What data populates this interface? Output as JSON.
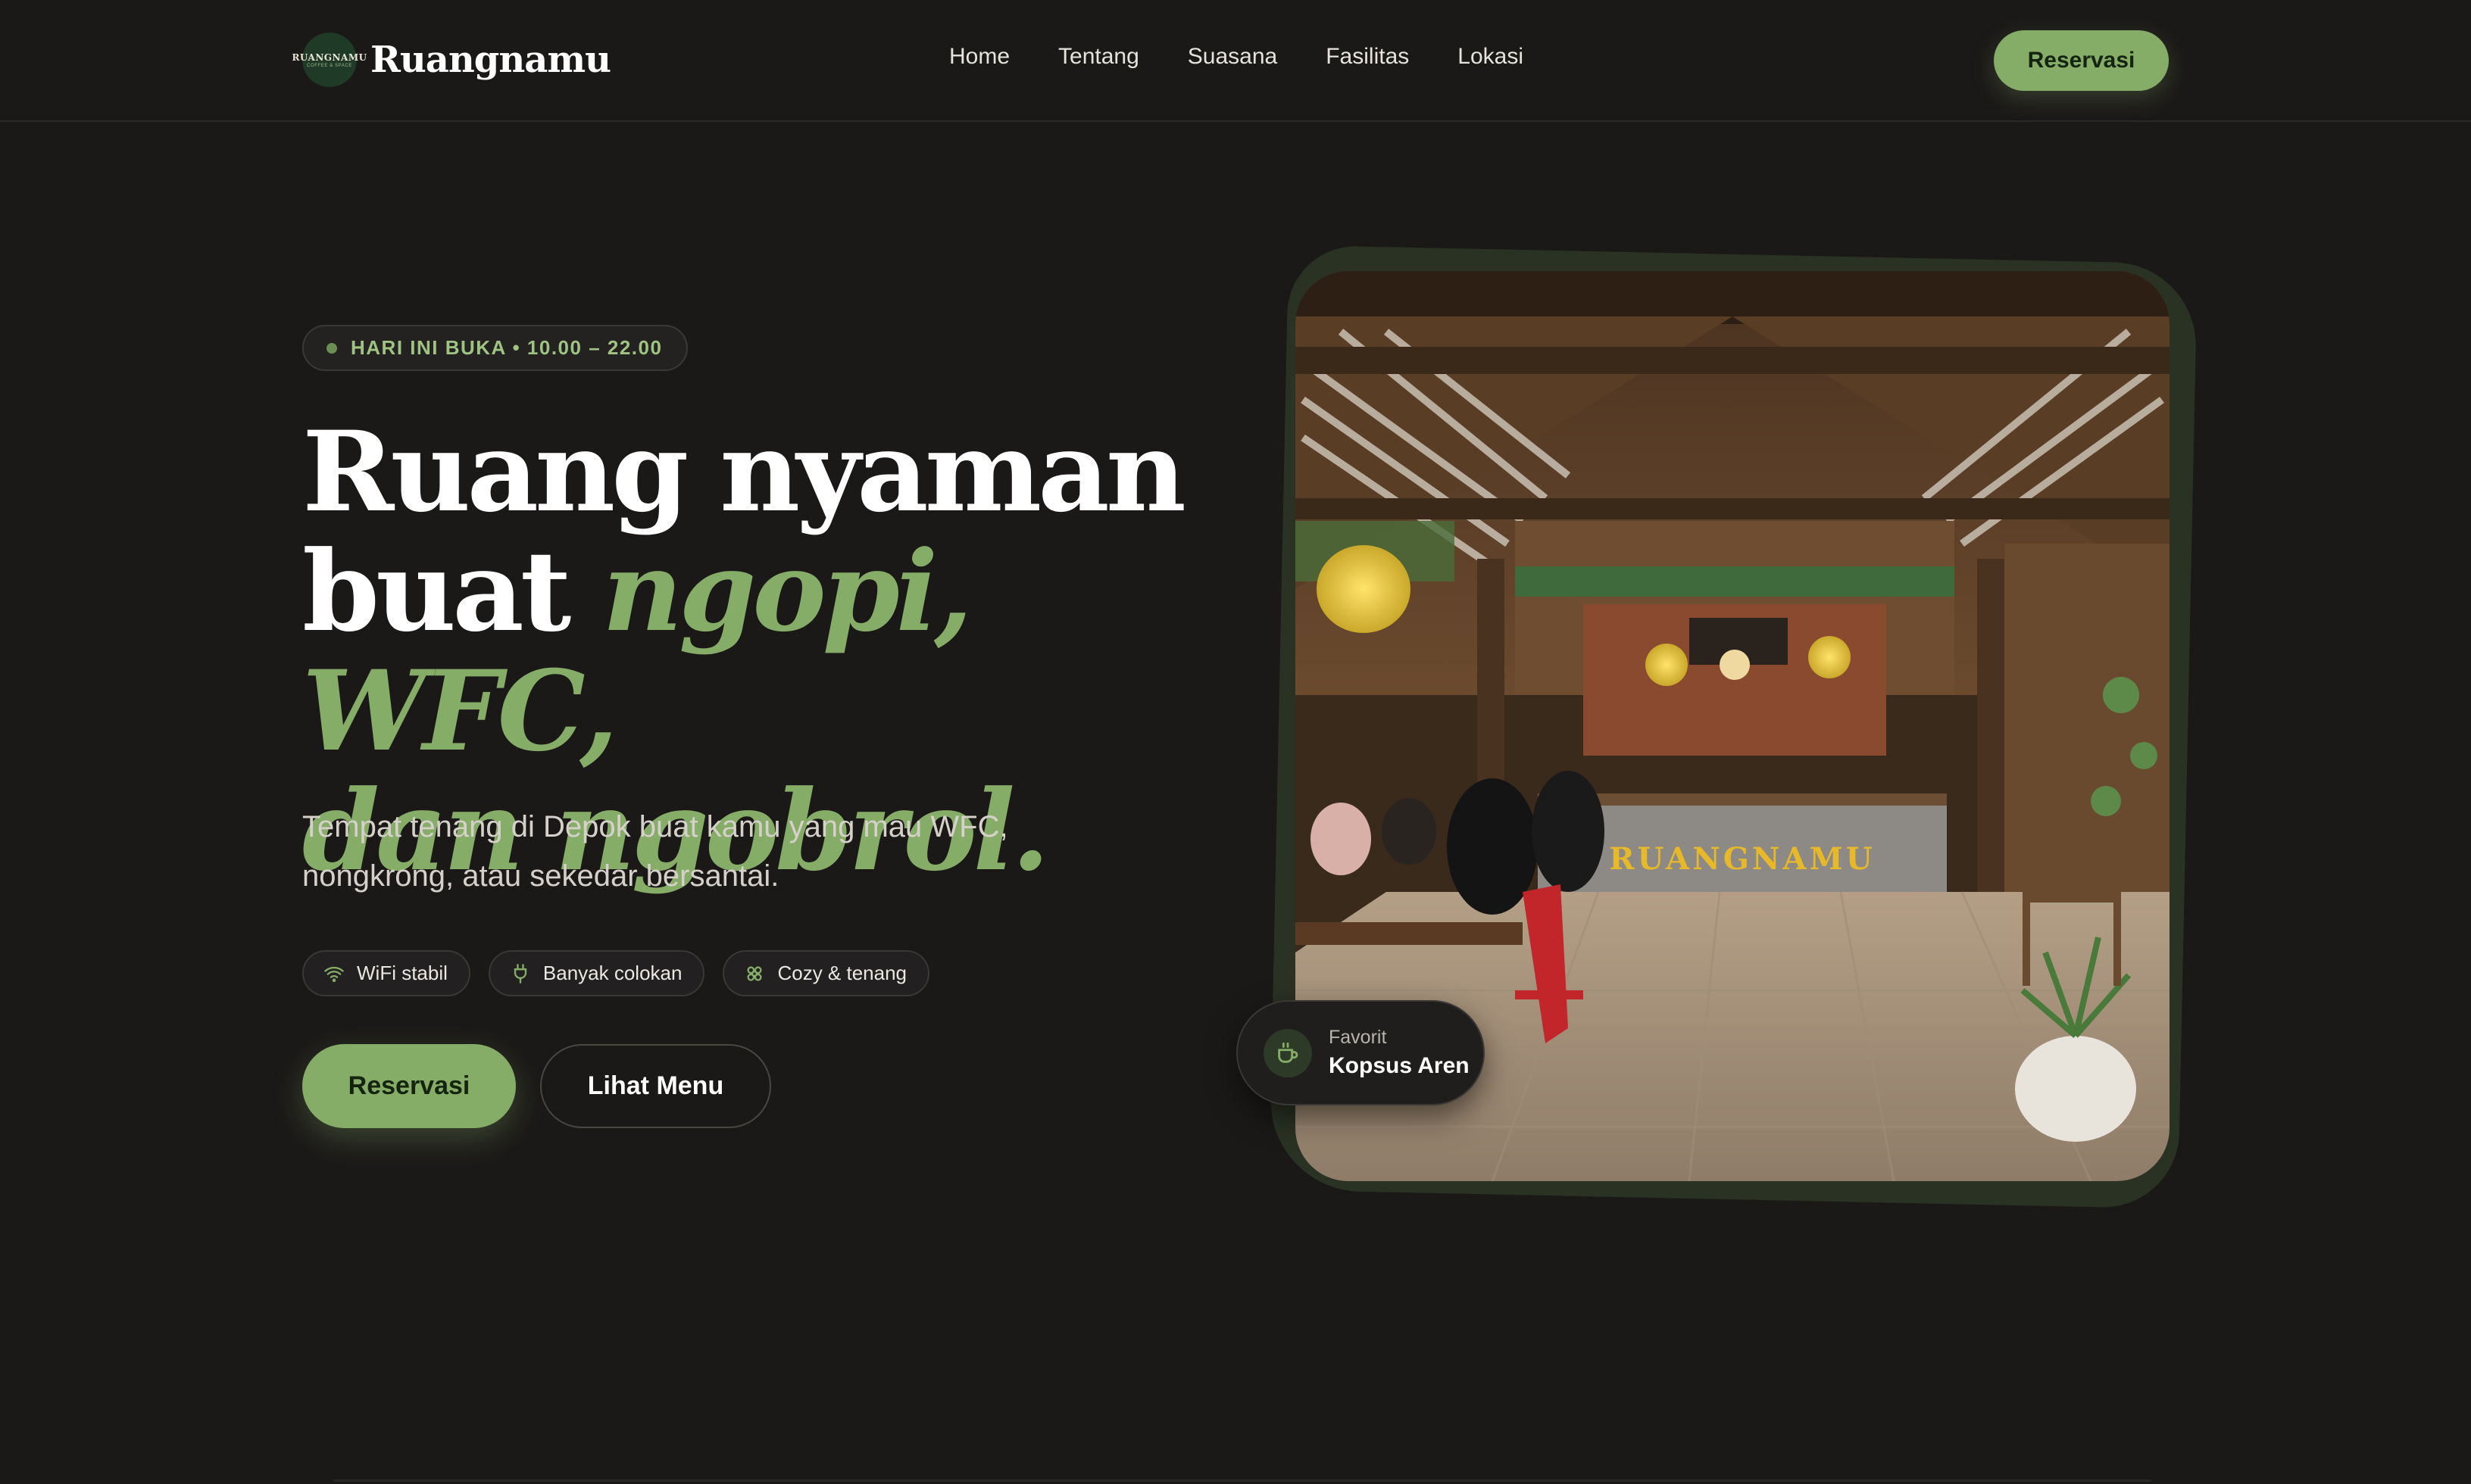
{
  "brand": {
    "logo_line1": "RUANGNAMU",
    "logo_line2": "COFFEE & SPACE",
    "name": "Ruangnamu"
  },
  "nav": {
    "links": [
      "Home",
      "Tentang",
      "Suasana",
      "Fasilitas",
      "Lokasi"
    ],
    "cta": "Reservasi"
  },
  "hero": {
    "badge": "HARI INI BUKA • 10.00 – 22.00",
    "headline": {
      "line1": "Ruang nyaman",
      "line2_plain": "buat ",
      "line2_accent": "ngopi, WFC,",
      "line3_accent": "dan ngobrol."
    },
    "subtext": "Tempat tenang di Depok buat kamu yang mau WFC, nongkrong, atau sekedar bersantai.",
    "chips": [
      {
        "icon": "wifi-icon",
        "label": "WiFi stabil"
      },
      {
        "icon": "plug-icon",
        "label": "Banyak colokan"
      },
      {
        "icon": "flower-icon",
        "label": "Cozy & tenang"
      }
    ],
    "primary_button": "Reservasi",
    "secondary_button": "Lihat Menu",
    "photo_sign": "RUANGNAMU",
    "favorite": {
      "label": "Favorit",
      "value": "Kopsus Aren",
      "icon": "coffee-cup-icon"
    }
  },
  "colors": {
    "accent": "#86ad67",
    "background": "#1b1918"
  }
}
